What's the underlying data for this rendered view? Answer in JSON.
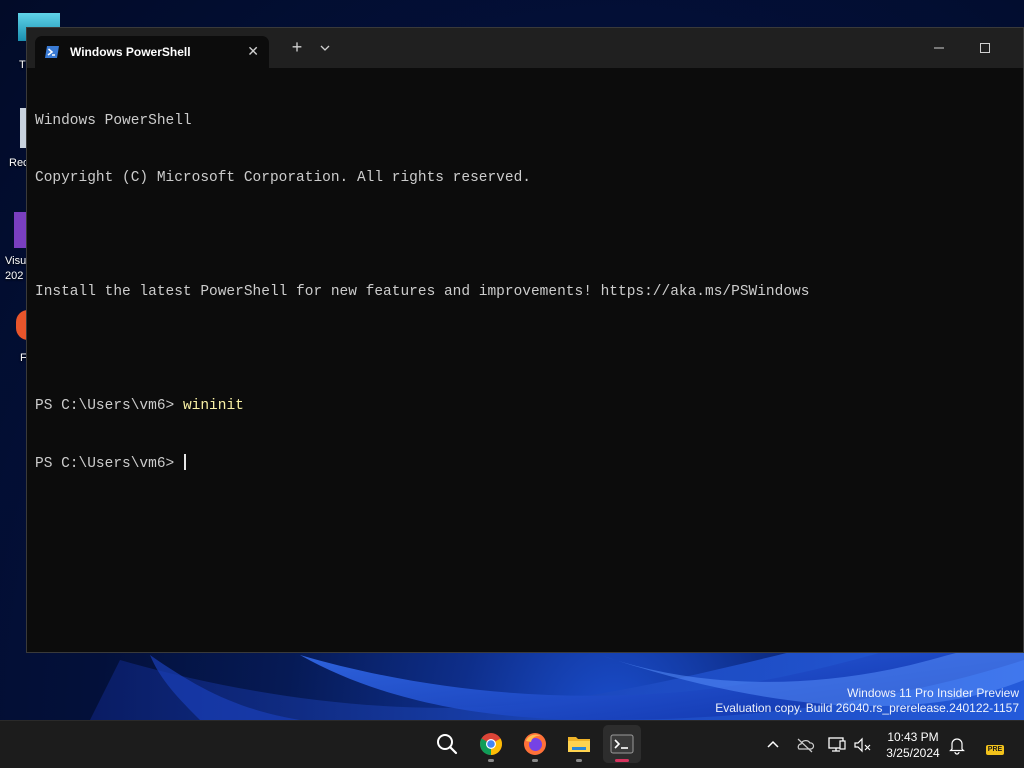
{
  "desktop": {
    "icons": [
      {
        "label": "T"
      },
      {
        "label": "Rec"
      },
      {
        "label": "Visu"
      },
      {
        "label": "202"
      },
      {
        "label": "F"
      }
    ]
  },
  "window": {
    "tab_title": "Windows PowerShell",
    "tab_close": "✕",
    "new_tab": "+",
    "console": {
      "lines": [
        "Windows PowerShell",
        "Copyright (C) Microsoft Corporation. All rights reserved.",
        "",
        "Install the latest PowerShell for new features and improvements! https://aka.ms/PSWindows",
        ""
      ],
      "prompt1": "PS C:\\Users\\vm6> ",
      "command1": "wininit",
      "prompt2": "PS C:\\Users\\vm6> "
    }
  },
  "watermark": {
    "line1": "Windows 11 Pro Insider Preview",
    "line2": "Evaluation copy. Build 26040.rs_prerelease.240122-1157"
  },
  "taskbar": {
    "apps": [
      "search-icon",
      "chrome-icon",
      "firefox-icon",
      "file-explorer-icon",
      "terminal-icon"
    ],
    "clock": {
      "time": "10:43 PM",
      "date": "3/25/2024"
    },
    "tray_badge": "PRE"
  }
}
